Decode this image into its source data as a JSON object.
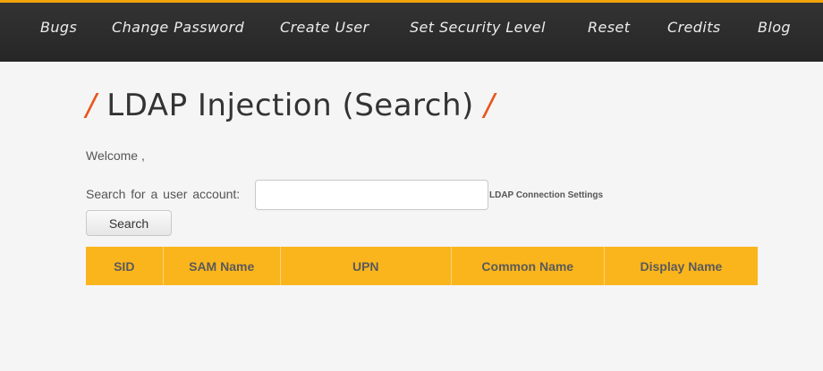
{
  "nav": {
    "items": [
      {
        "label": "Bugs"
      },
      {
        "label": "Change Password"
      },
      {
        "label": "Create User"
      },
      {
        "label": "Set Security Level"
      },
      {
        "label": "Reset"
      },
      {
        "label": "Credits"
      },
      {
        "label": "Blog"
      }
    ]
  },
  "page": {
    "title_prefix": "/",
    "title": "LDAP Injection (Search)",
    "title_suffix": "/",
    "welcome": "Welcome ,"
  },
  "search": {
    "label": "Search for a user account:",
    "value": "",
    "button_label": "Search",
    "ldap_settings_link": "LDAP Connection Settings"
  },
  "table": {
    "headers": [
      "SID",
      "SAM Name",
      "UPN",
      "Common Name",
      "Display Name"
    ],
    "rows": []
  },
  "colors": {
    "accent": "#f0a30a",
    "slash": "#e8561b",
    "table_header_bg": "#fbb51c",
    "navbar_bg": "#2b2b2b"
  }
}
